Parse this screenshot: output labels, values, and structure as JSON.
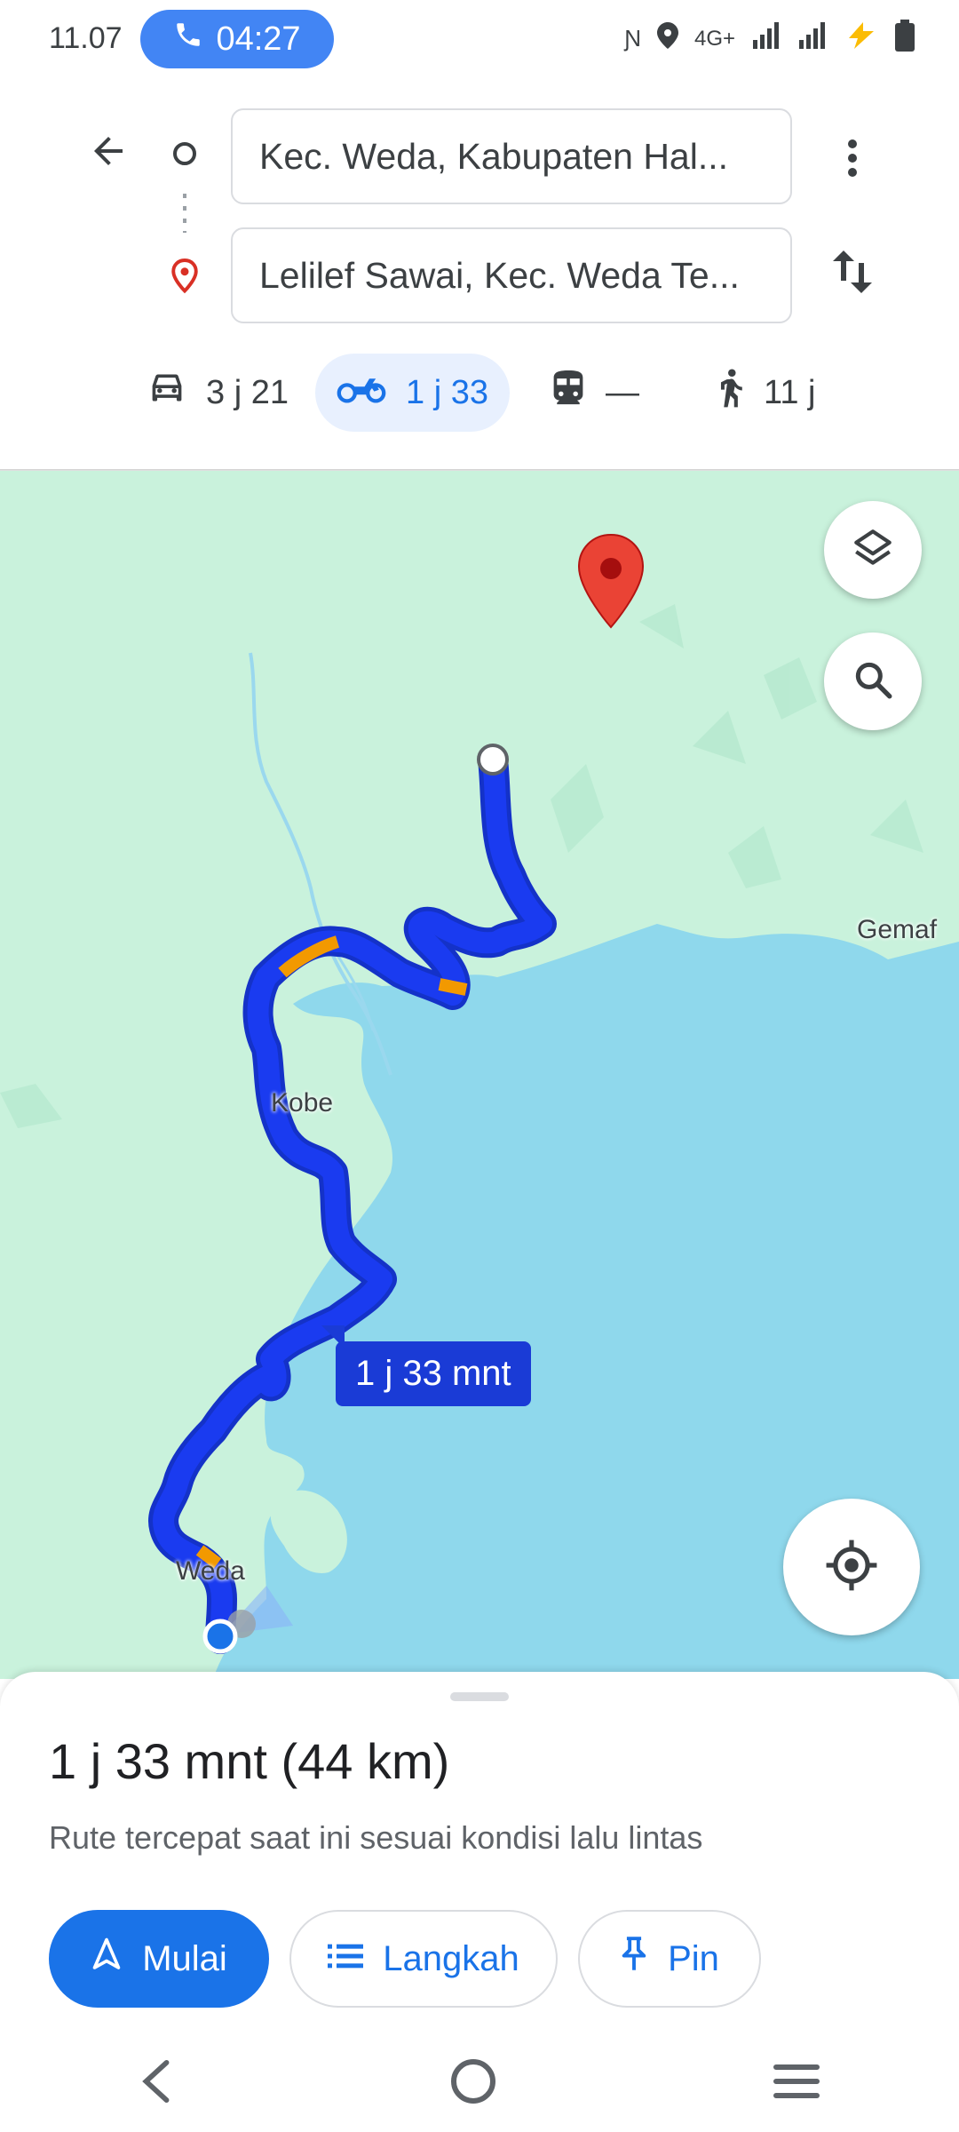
{
  "status_bar": {
    "time": "11.07",
    "call_timer": "04:27",
    "network": "4G+"
  },
  "search": {
    "origin": "Kec. Weda, Kabupaten Hal...",
    "destination": "Lelilef Sawai, Kec. Weda Te..."
  },
  "modes": [
    {
      "icon": "car-icon",
      "label": "3 j 21",
      "active": false
    },
    {
      "icon": "motorcycle-icon",
      "label": "1 j 33",
      "active": true
    },
    {
      "icon": "transit-icon",
      "label": "—",
      "active": false
    },
    {
      "icon": "walk-icon",
      "label": "11 j",
      "active": false
    }
  ],
  "map": {
    "labels": {
      "gemaf": "Gemaf",
      "kobe": "Kobe",
      "weda": "Weda"
    },
    "eta_badge": "1 j 33 mnt",
    "route_color": "#1a3bf0",
    "traffic_color": "#f29900",
    "destination_pin_color": "#ea4335"
  },
  "sheet": {
    "summary": "1 j 33 mnt (44 km)",
    "subtitle": "Rute tercepat saat ini sesuai kondisi lalu lintas",
    "buttons": {
      "start": "Mulai",
      "steps": "Langkah",
      "pin": "Pin"
    }
  },
  "colors": {
    "accent": "#1a73e8",
    "map_land": "#c9f2dc",
    "map_water": "#8fd8ec"
  }
}
